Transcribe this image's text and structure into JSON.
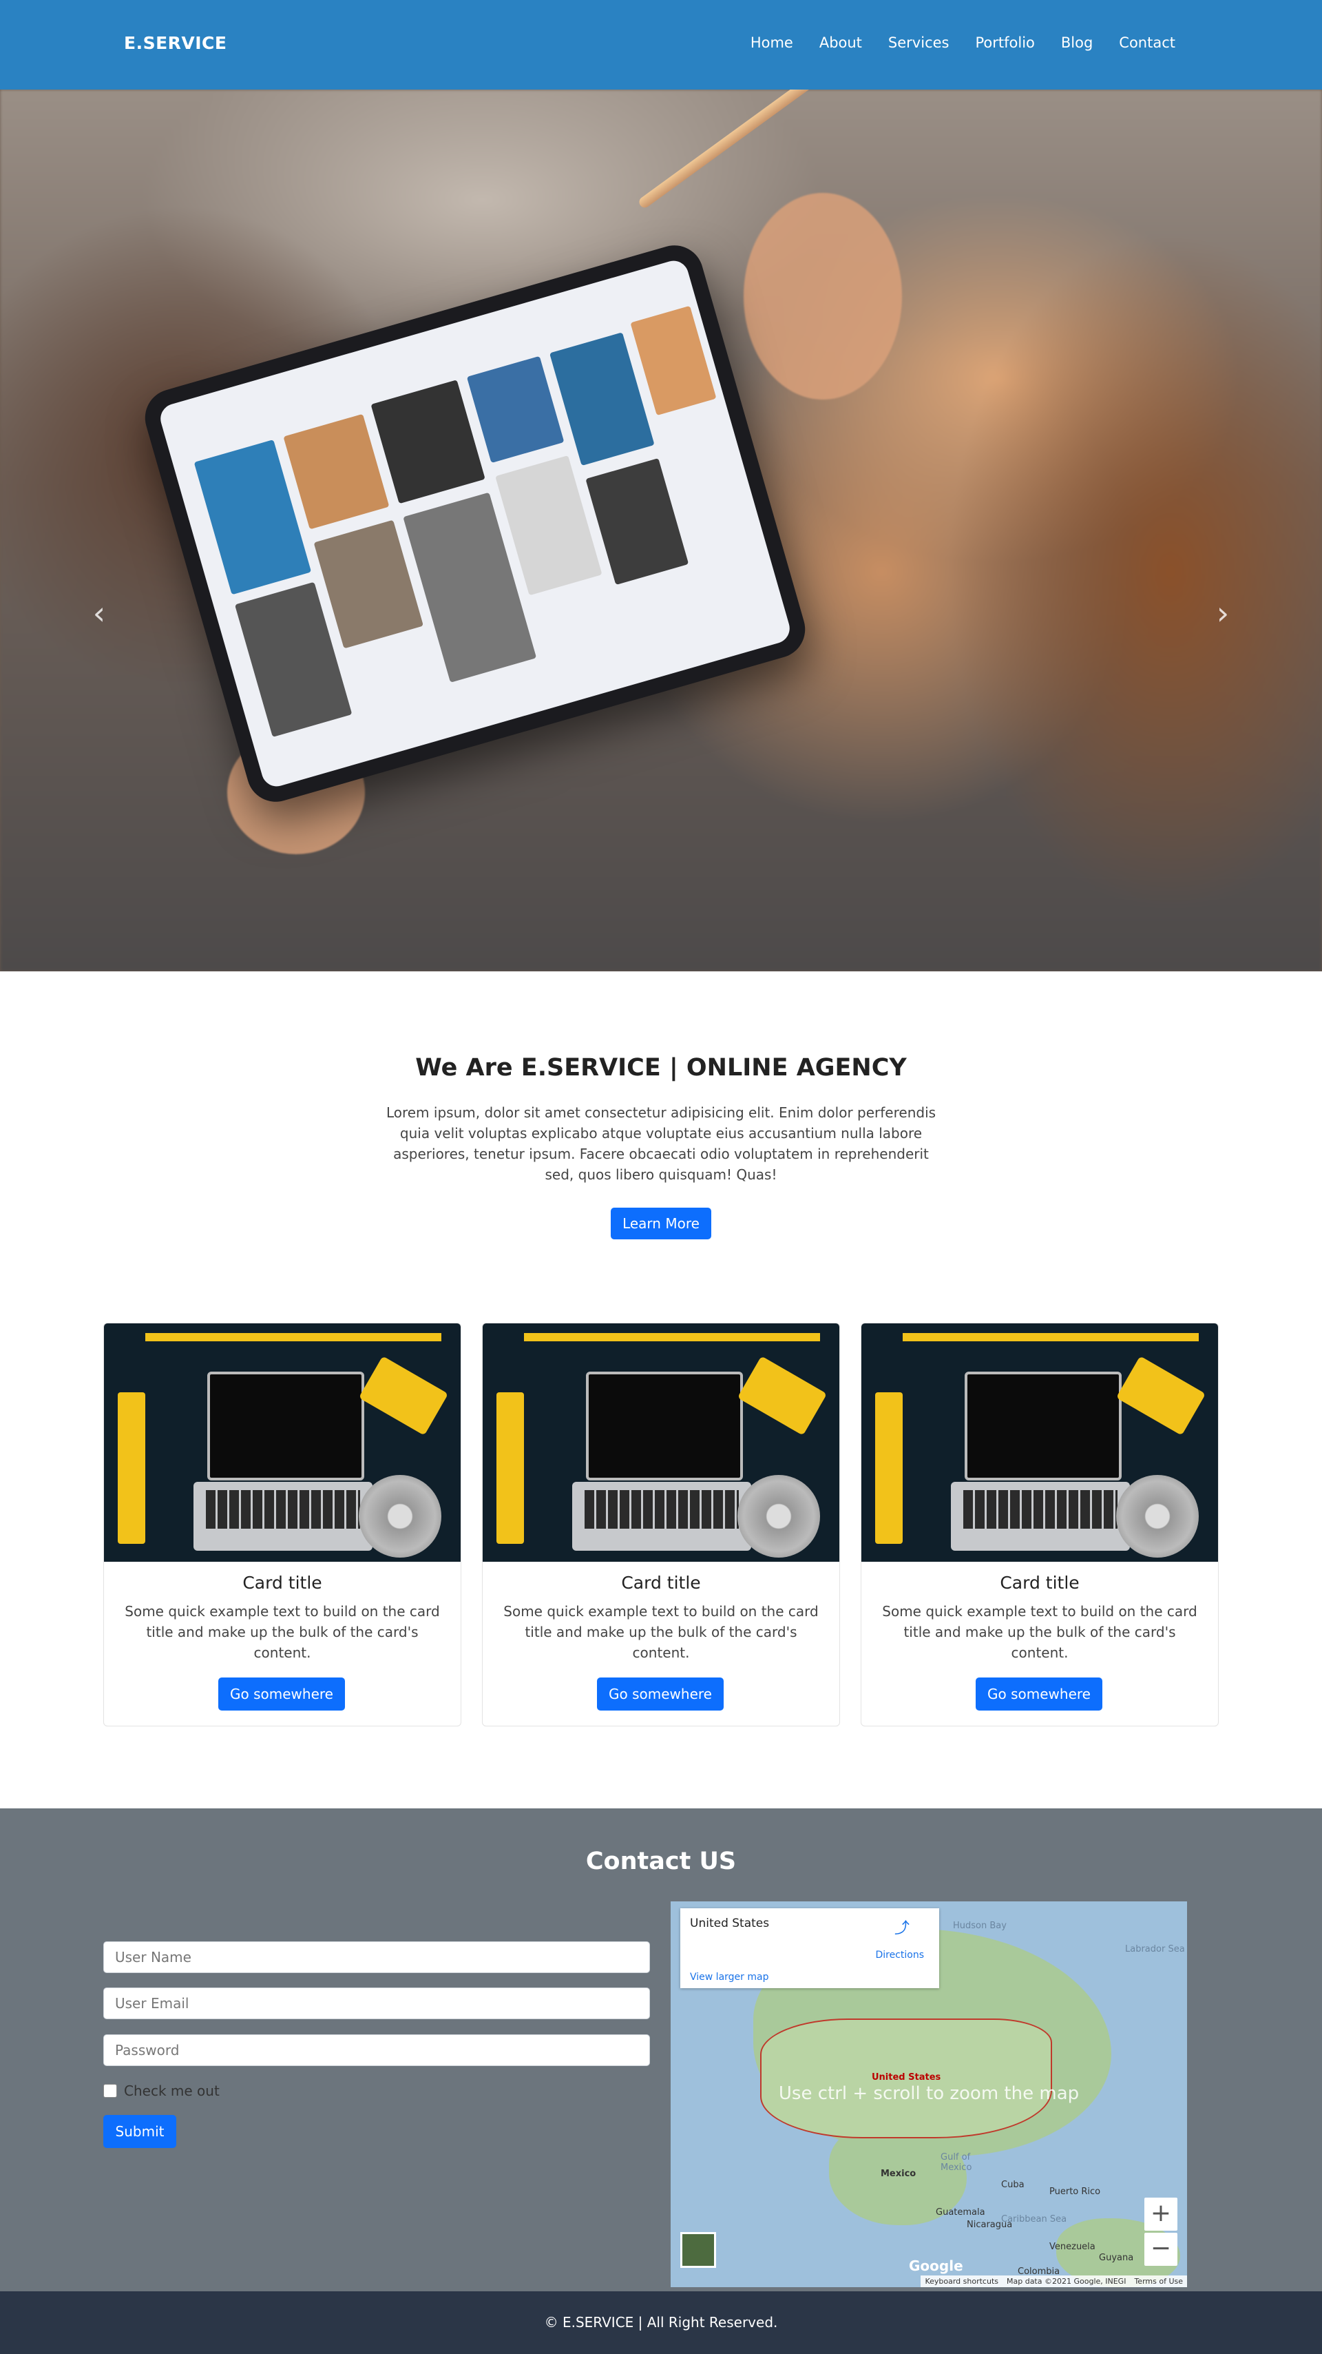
{
  "navbar": {
    "brand": "E.SERVICE",
    "links": [
      "Home",
      "About",
      "Services",
      "Portfolio",
      "Blog",
      "Contact"
    ]
  },
  "hero": {
    "prev_icon": "chevron-left-icon",
    "next_icon": "chevron-right-icon",
    "slides_count": 3,
    "active_slide": 2
  },
  "about": {
    "title": "We Are E.SERVICE | ONLINE AGENCY",
    "text": "Lorem ipsum, dolor sit amet consectetur adipisicing elit. Enim dolor perferendis quia velit voluptas explicabo atque voluptate eius accusantium nulla labore asperiores, tenetur ipsum. Facere obcaecati odio voluptatem in reprehenderit sed, quos libero quisquam! Quas!",
    "button": "Learn More"
  },
  "cards": [
    {
      "title": "Card title",
      "text": "Some quick example text to build on the card title and make up the bulk of the card's content.",
      "button": "Go somewhere"
    },
    {
      "title": "Card title",
      "text": "Some quick example text to build on the card title and make up the bulk of the card's content.",
      "button": "Go somewhere"
    },
    {
      "title": "Card title",
      "text": "Some quick example text to build on the card title and make up the bulk of the card's content.",
      "button": "Go somewhere"
    }
  ],
  "contact": {
    "title": "Contact US",
    "form": {
      "username_placeholder": "User Name",
      "email_placeholder": "User Email",
      "password_placeholder": "Password",
      "checkbox_label": "Check me out",
      "submit": "Submit"
    },
    "map": {
      "place": "United States",
      "directions": "Directions",
      "larger_map": "View larger map",
      "hint": "Use ctrl + scroll to zoom the map",
      "zoom_in": "+",
      "zoom_out": "−",
      "logo": "Google",
      "footer_links": [
        "Keyboard shortcuts",
        "Map data ©2021 Google, INEGI",
        "Terms of Use"
      ],
      "labels": [
        "Hudson Bay",
        "Labrador Sea",
        "United States",
        "Mexico",
        "Gulf of Mexico",
        "Cuba",
        "Puerto Rico",
        "Caribbean Sea",
        "Guatemala",
        "Nicaragua",
        "Venezuela",
        "Guyana",
        "Colombia"
      ]
    }
  },
  "footer": {
    "text": "© E.SERVICE | All Right Reserved."
  },
  "colors": {
    "navbar": "#2a82c2",
    "primary_button": "#0d6efd",
    "contact_bg": "#6c757d",
    "footer_bg": "#2b3647"
  }
}
